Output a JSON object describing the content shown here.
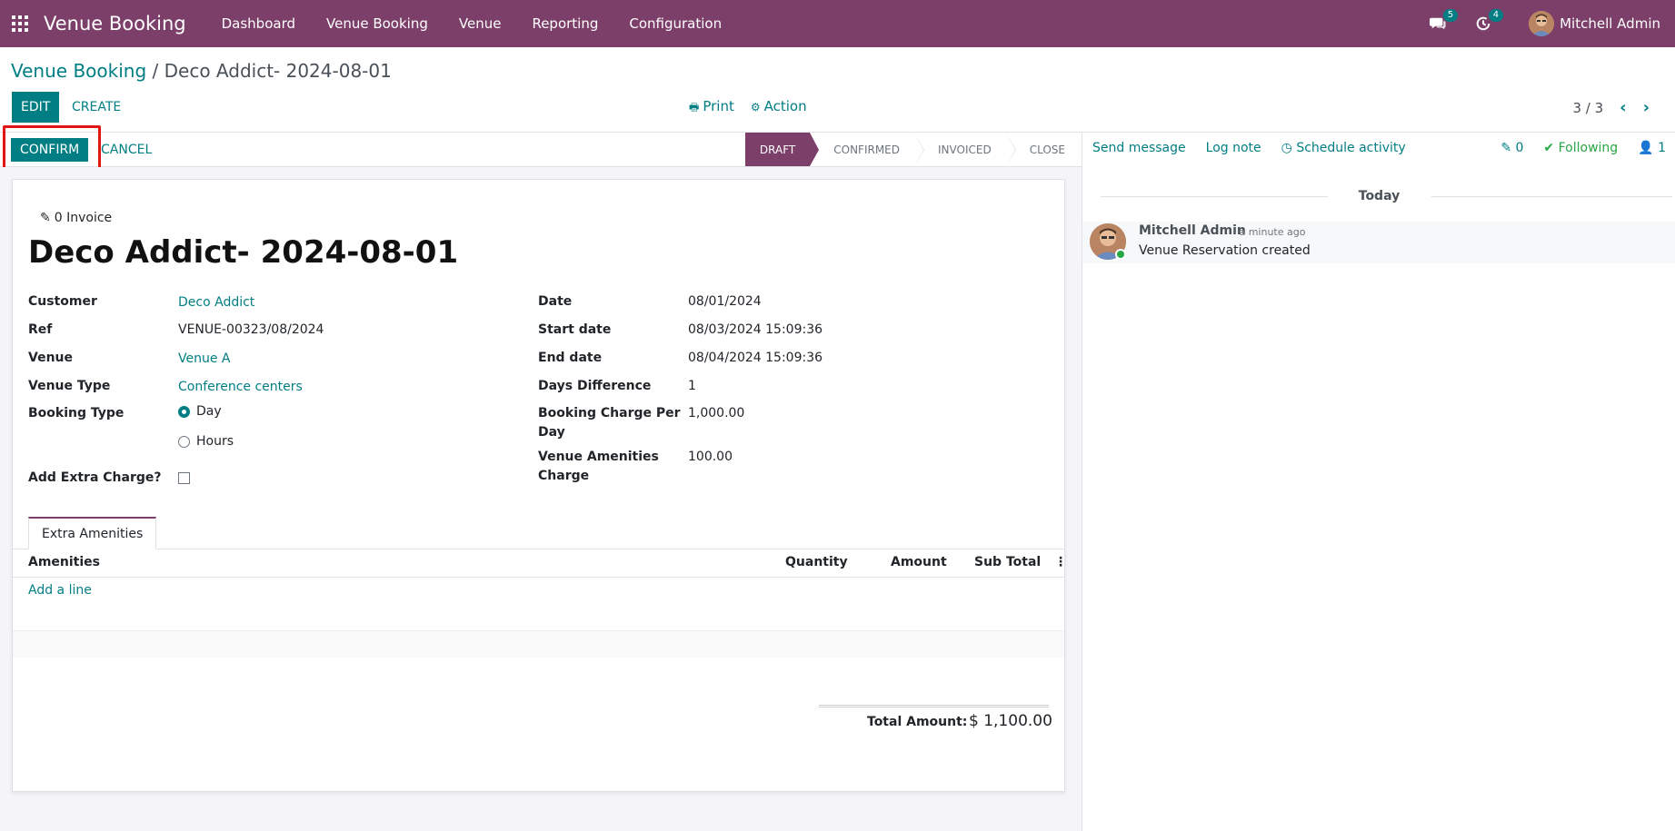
{
  "navbar": {
    "app_title": "Venue Booking",
    "menu": [
      "Dashboard",
      "Venue Booking",
      "Venue",
      "Reporting",
      "Configuration"
    ],
    "messages_count": "5",
    "activities_count": "4",
    "user_name": "Mitchell Admin",
    "bg_color": "#7c3f69"
  },
  "control": {
    "breadcrumb_parent": "Venue Booking",
    "breadcrumb_sep": "/",
    "breadcrumb_current": "Deco Addict- 2024-08-01",
    "edit_label": "EDIT",
    "create_label": "CREATE",
    "print_label": "Print",
    "action_label": "Action",
    "pager": "3 / 3"
  },
  "statusbar": {
    "confirm_label": "CONFIRM",
    "cancel_label": "CANCEL",
    "stages": [
      "DRAFT",
      "CONFIRMED",
      "INVOICED",
      "CLOSE"
    ],
    "active_stage": "DRAFT"
  },
  "form": {
    "invoice_smart_button": "0 Invoice",
    "title": "Deco Addict- 2024-08-01",
    "left": [
      {
        "label": "Customer",
        "value": "Deco Addict"
      },
      {
        "label": "Ref",
        "value": "VENUE-00323/08/2024"
      },
      {
        "label": "Venue",
        "value": "Venue A"
      },
      {
        "label": "Venue Type",
        "value": "Conference centers"
      }
    ],
    "booking_type_label": "Booking Type",
    "booking_type_options": [
      "Day",
      "Hours"
    ],
    "booking_type_selected": "Day",
    "extra_charge_label": "Add Extra Charge?",
    "right": [
      {
        "label": "Date",
        "value": "08/01/2024"
      },
      {
        "label": "Start date",
        "value": "08/03/2024 15:09:36"
      },
      {
        "label": "End date",
        "value": "08/04/2024 15:09:36"
      },
      {
        "label": "Days Difference",
        "value": "1"
      }
    ],
    "booking_charge_label_1": "Booking Charge Per",
    "booking_charge_label_2": "Day",
    "booking_charge_value": "1,000.00",
    "amenities_charge_label_1": "Venue Amenities",
    "amenities_charge_label_2": "Charge",
    "amenities_charge_value": "100.00",
    "tab_label": "Extra Amenities",
    "table_headers": [
      "Amenities",
      "Quantity",
      "Amount",
      "Sub Total"
    ],
    "add_line": "Add a line",
    "total_label": "Total Amount:",
    "total_value": "$ 1,100.00"
  },
  "chatter": {
    "send_message": "Send message",
    "log_note": "Log note",
    "schedule_activity": "Schedule activity",
    "attachments": "0",
    "following": "Following",
    "followers": "1",
    "today": "Today",
    "message": {
      "author": "Mitchell Admin",
      "time": "- a minute ago",
      "body": "Venue Reservation created"
    }
  }
}
